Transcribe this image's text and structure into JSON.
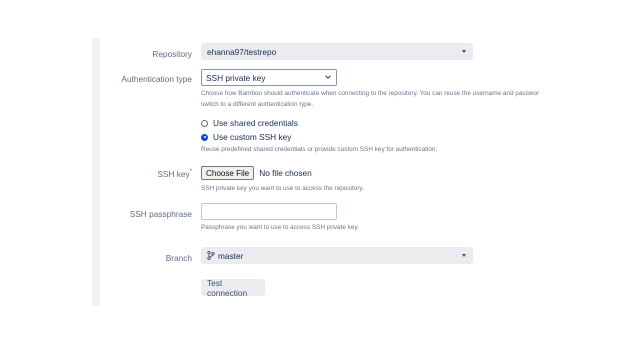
{
  "repository": {
    "label": "Repository",
    "value": "ehanna97/testrepo"
  },
  "auth_type": {
    "label": "Authentication type",
    "value": "SSH private key",
    "help_line1": "Choose how Bamboo should authenticate when connecting to the repository. You can reuse the username and passwor",
    "help_line2": "switch to a different authentication type."
  },
  "credentials": {
    "options": [
      {
        "label": "Use shared credentials",
        "checked": false
      },
      {
        "label": "Use custom SSH key",
        "checked": true
      }
    ],
    "help": "Reuse predefined shared credentials or provide custom SSH key for authentication."
  },
  "ssh_key": {
    "label": "SSH key",
    "required_marker": "*",
    "button_label": "Choose File",
    "file_status": "No file chosen",
    "help": "SSH private key you want to use to access the repository."
  },
  "ssh_passphrase": {
    "label": "SSH passphrase",
    "value": "",
    "help": "Passphrase you want to use to access SSH private key."
  },
  "branch": {
    "label": "Branch",
    "value": "master"
  },
  "actions": {
    "test_connection": "Test connection"
  },
  "icons": {
    "branch": "git-branch-icon",
    "caret": "caret-down-icon",
    "chevron": "chevron-down-icon"
  }
}
